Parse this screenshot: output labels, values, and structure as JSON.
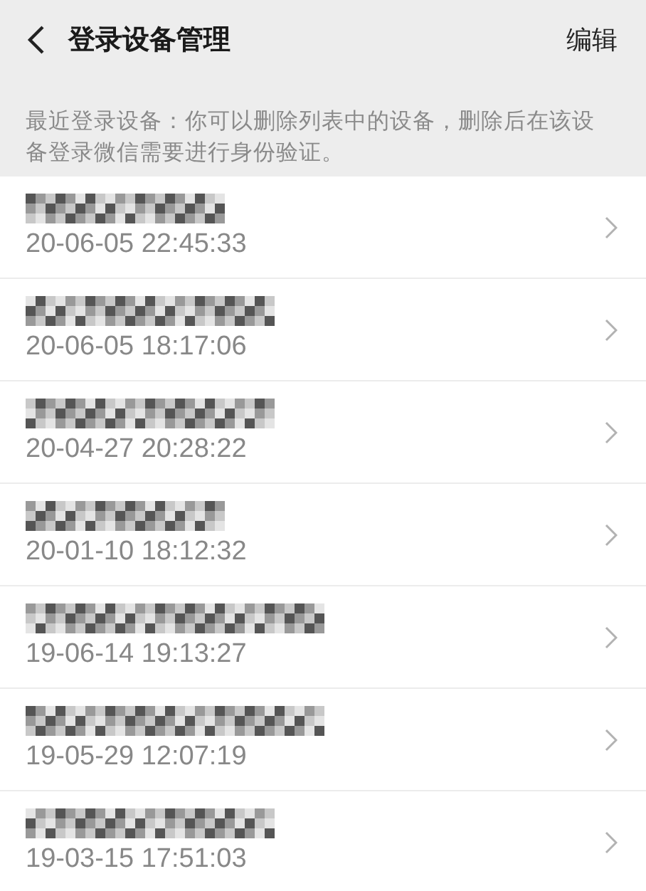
{
  "header": {
    "title": "登录设备管理",
    "action": "编辑"
  },
  "notice": "最近登录设备：你可以删除列表中的设备，删除后在该设备登录微信需要进行身份验证。",
  "devices": [
    {
      "time": "20-06-05 22:45:33"
    },
    {
      "time": "20-06-05 18:17:06"
    },
    {
      "time": "20-04-27 20:28:22"
    },
    {
      "time": "20-01-10 18:12:32"
    },
    {
      "time": "19-06-14 19:13:27"
    },
    {
      "time": "19-05-29 12:07:19"
    },
    {
      "time": "19-03-15 17:51:03"
    }
  ]
}
